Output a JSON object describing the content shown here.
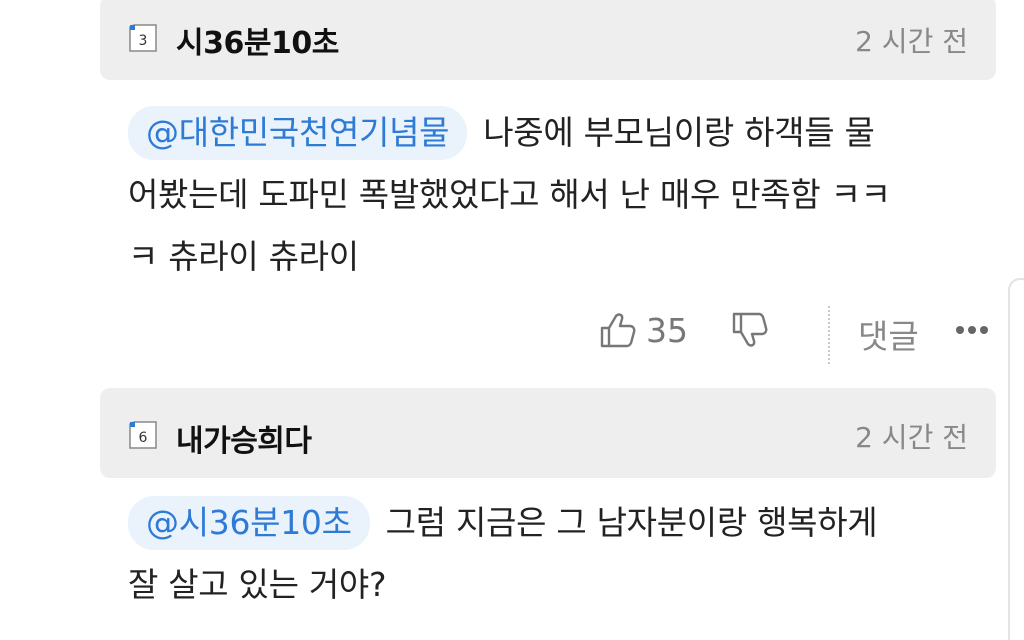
{
  "comments": [
    {
      "level_badge": "3",
      "nickname": "시36분10초",
      "time": "2 시간 전",
      "mention": "@대한민국천연기념물",
      "text_line1": "나중에 부모님이랑 하객들 물",
      "text_line2": "어봤는데 도파민 폭발했었다고 해서 난 매우 만족함 ㅋㅋ",
      "text_line3": "ㅋ 츄라이 츄라이",
      "likes": "35",
      "reply_label": "댓글"
    },
    {
      "level_badge": "6",
      "nickname": "내가승희다",
      "time": "2 시간 전",
      "mention": "@시36분10초",
      "text_line1": "그럼 지금은 그 남자분이랑 행복하게",
      "text_line2": "잘 살고 있는 거야?"
    }
  ],
  "icons": {
    "like": "thumbs-up-icon",
    "dislike": "thumbs-down-icon",
    "more": "more-icon",
    "badge": "level-badge-icon"
  },
  "colors": {
    "header_bg": "#eeeeee",
    "mention_bg": "#eaf2fb",
    "mention_text": "#2e7bd6",
    "muted": "#888888"
  }
}
